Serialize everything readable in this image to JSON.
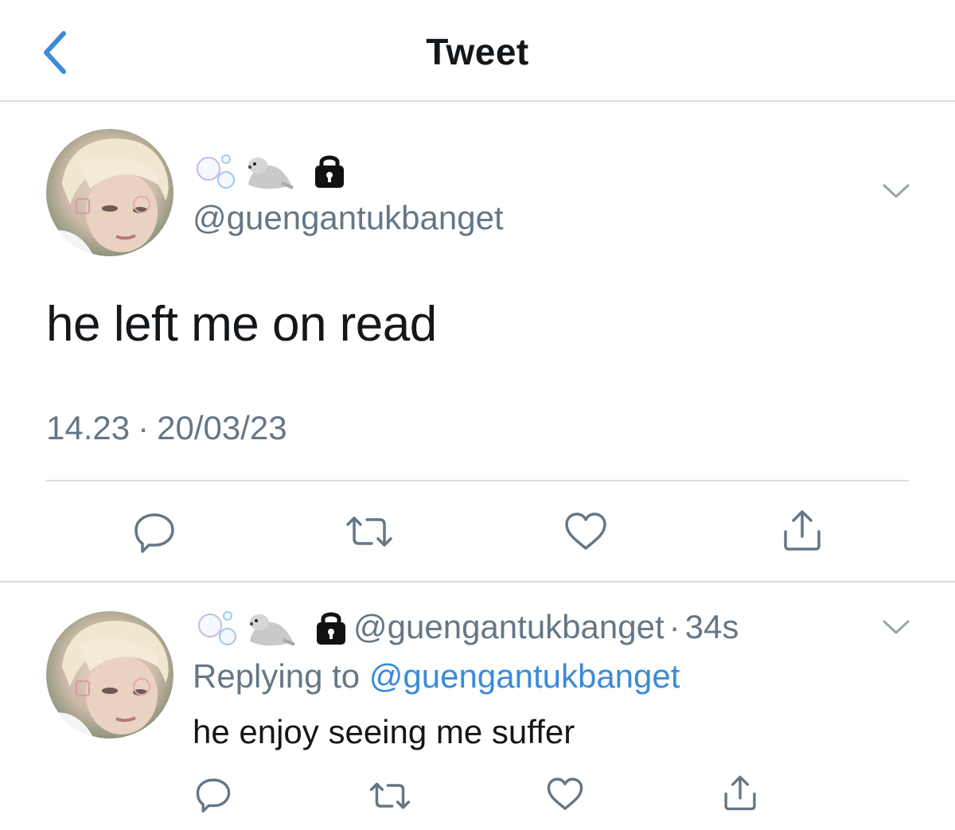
{
  "nav": {
    "back_icon": "chevron-left-icon",
    "title": "Tweet",
    "accent": "#3b8bd8"
  },
  "main_tweet": {
    "display_name_icons": [
      "bubbles-icon",
      "seal-icon",
      "lock-icon"
    ],
    "handle": "@guengantukbanget",
    "text": "he left me on read",
    "time": "14.23",
    "separator": "·",
    "date": "20/03/23",
    "actions": [
      "reply-icon",
      "retweet-icon",
      "like-icon",
      "share-icon"
    ]
  },
  "reply_tweet": {
    "display_name_icons": [
      "bubbles-icon",
      "seal-icon",
      "lock-icon"
    ],
    "handle": "@guengantukbanget",
    "separator": "·",
    "age": "34s",
    "replying_prefix": "Replying to",
    "replying_handle": "@guengantukbanget",
    "text": "he enjoy seeing me suffer",
    "actions": [
      "reply-icon",
      "retweet-icon",
      "like-icon",
      "share-icon"
    ]
  },
  "colors": {
    "text": "#14171a",
    "secondary": "#657786",
    "link": "#3b8bd8",
    "divider": "#dcdde0"
  }
}
